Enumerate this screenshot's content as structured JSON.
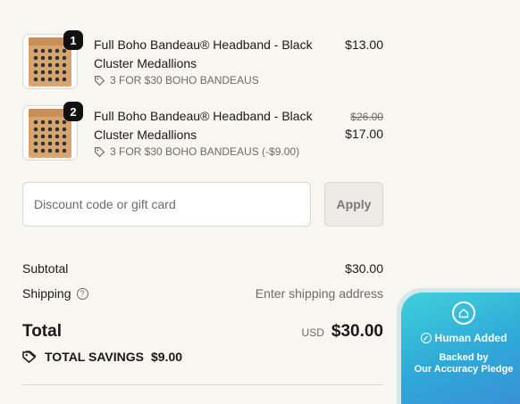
{
  "items": [
    {
      "quantity": "1",
      "title": "Full Boho Bandeau® Headband - Black Cluster Medallions",
      "discount": "3 FOR $30 BOHO BANDEAUS",
      "price": "$13.00",
      "original_price": ""
    },
    {
      "quantity": "2",
      "title": "Full Boho Bandeau® Headband - Black Cluster Medallions",
      "discount": "3 FOR $30 BOHO BANDEAUS (-$9.00)",
      "price": "$17.00",
      "original_price": "$26.00"
    }
  ],
  "discount_form": {
    "placeholder": "Discount code or gift card",
    "apply_label": "Apply"
  },
  "summary": {
    "subtotal_label": "Subtotal",
    "subtotal_value": "$30.00",
    "shipping_label": "Shipping",
    "shipping_value": "Enter shipping address",
    "total_label": "Total",
    "currency": "USD",
    "total_value": "$30.00",
    "savings_label": "TOTAL SAVINGS",
    "savings_value": "$9.00"
  },
  "badge": {
    "title": "Human Added",
    "line1": "Backed by",
    "line2": "Our Accuracy Pledge"
  },
  "icons": [
    "tag-icon",
    "help-icon",
    "home-icon",
    "check-icon"
  ],
  "colors": {
    "background": "#f7f6f0",
    "badge_gradient_start": "#3fd0da",
    "badge_gradient_end": "#3a8fd6"
  }
}
